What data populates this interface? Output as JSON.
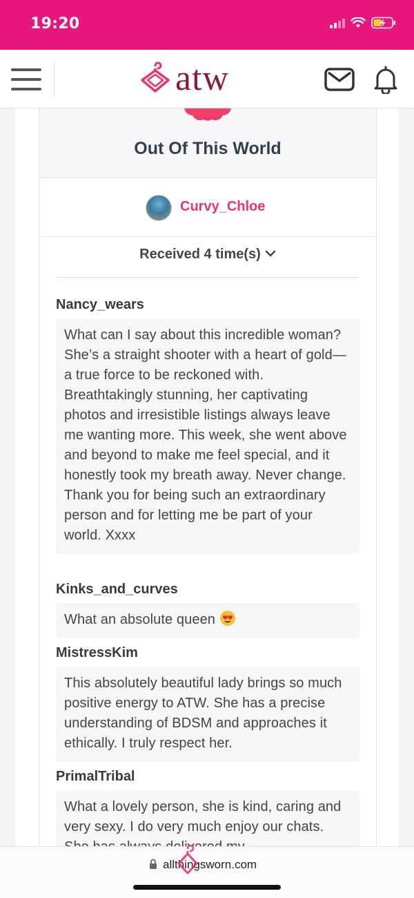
{
  "status_bar": {
    "time": "19:20",
    "icons": [
      "signal-icon",
      "wifi-icon",
      "battery-charging-icon"
    ],
    "background": "#e8157d"
  },
  "header": {
    "logo_text": "atw",
    "icons": [
      "menu-icon",
      "hanger-logo-icon",
      "mail-icon",
      "bell-icon"
    ],
    "brand_color": "#8b1b3a",
    "accent_color": "#e8336b"
  },
  "award": {
    "title": "Out Of This World",
    "recipient": "Curvy_Chloe",
    "received_label": "Received 4 time(s)"
  },
  "reviews": [
    {
      "author": "Nancy_wears",
      "text": "What can I say about this incredible woman? She’s a straight shooter with a heart of gold—a true force to be reckoned with. Breathtakingly stunning, her captivating photos and irresistible listings always leave me wanting more. This week, she went above and beyond to make me feel special, and it honestly took my breath away. Never change. Thank you for being such an extraordinary person and for letting me be part of your world. Xxxx"
    },
    {
      "author": "Kinks_and_curves",
      "text": "What an absolute queen",
      "emoji": "heart-eyes-emoji"
    },
    {
      "author": "MistressKim",
      "text": "This absolutely beautiful lady brings so much positive energy to ATW. She has a precise understanding of BDSM and approaches it ethically. I truly respect her."
    },
    {
      "author": "PrimalTribal",
      "text": "What a lovely person, she is kind, caring and very sexy. I do very much enjoy our chats. She has always delivered my"
    }
  ],
  "browser": {
    "url": "allthingsworn.com"
  }
}
